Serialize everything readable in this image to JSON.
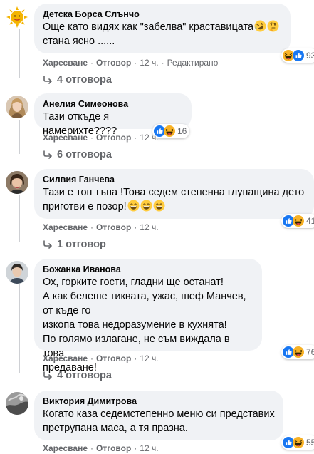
{
  "actions": {
    "like": "Харесване",
    "reply": "Отговор",
    "edited": "Редактирано"
  },
  "comments": [
    {
      "author": "Детска Борса Слънчо",
      "text": "Още като видях как \"забелва\" краставицата",
      "text2": "стана ясно ......",
      "time": "12 ч.",
      "reaction_count": "93",
      "replies": "4 отговора"
    },
    {
      "author": "Анелия Симеонова",
      "text": "Тази откъде я намерихте????",
      "time": "12 ч.",
      "reaction_count": "16",
      "replies": "6 отговора"
    },
    {
      "author": "Силвия Ганчева",
      "text": "Тази е топ тъпа !Това седем степенна глупащина дето",
      "text2": "приготви е позор!",
      "time": "12 ч.",
      "reaction_count": "41",
      "replies": "1 отговор"
    },
    {
      "author": "Божанка Иванова",
      "text": "Ох, горките гости, гладни ще останат!\nА как белеше тиквата, ужас, шеф Манчев, от къде го\nизкопа това недоразумение в кухнята!\nПо голямо излагане, не съм виждала в това\nпредаване!",
      "time": "12 ч.",
      "reaction_count": "76",
      "replies": "4 отговора"
    },
    {
      "author": "Виктория Димитрова",
      "text": "Когато каза седемстепенно меню си представих\nпретрупана маса, а тя празна.",
      "time": "12 ч.",
      "reaction_count": "55"
    }
  ],
  "colors": {
    "bubble": "#f0f2f5",
    "meta": "#65676b",
    "like": "#1877f2",
    "haha": "#f7b125"
  }
}
